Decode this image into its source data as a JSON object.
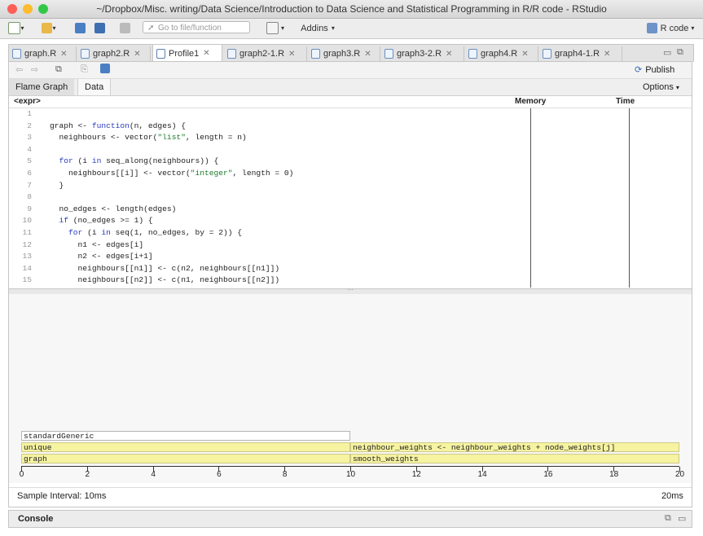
{
  "window": {
    "title": "~/Dropbox/Misc. writing/Data Science/Introduction to Data Science and Statistical Programming in R/R code - RStudio"
  },
  "toolbar": {
    "goto_placeholder": "Go to file/function",
    "addins_label": "Addins",
    "project_label": "R code"
  },
  "tabs": [
    {
      "label": "graph.R"
    },
    {
      "label": "graph2.R"
    },
    {
      "label": "Profile1"
    },
    {
      "label": "graph2-1.R"
    },
    {
      "label": "graph3.R"
    },
    {
      "label": "graph3-2.R"
    },
    {
      "label": "graph4.R"
    },
    {
      "label": "graph4-1.R"
    }
  ],
  "profile": {
    "publish_label": "Publish",
    "view_tabs": {
      "flame": "Flame Graph",
      "data": "Data"
    },
    "options_label": "Options",
    "columns": {
      "expr": "<expr>",
      "memory": "Memory",
      "time": "Time"
    },
    "code_lines": [
      {
        "n": "1",
        "t": ""
      },
      {
        "n": "2",
        "t": "graph <- function(n, edges) {"
      },
      {
        "n": "3",
        "t": "  neighbours <- vector(\"list\", length = n)"
      },
      {
        "n": "4",
        "t": ""
      },
      {
        "n": "5",
        "t": "  for (i in seq_along(neighbours)) {"
      },
      {
        "n": "6",
        "t": "    neighbours[[i]] <- vector(\"integer\", length = 0)"
      },
      {
        "n": "7",
        "t": "  }"
      },
      {
        "n": "8",
        "t": ""
      },
      {
        "n": "9",
        "t": "  no_edges <- length(edges)"
      },
      {
        "n": "10",
        "t": "  if (no_edges >= 1) {"
      },
      {
        "n": "11",
        "t": "    for (i in seq(1, no_edges, by = 2)) {"
      },
      {
        "n": "12",
        "t": "      n1 <- edges[i]"
      },
      {
        "n": "13",
        "t": "      n2 <- edges[i+1]"
      },
      {
        "n": "14",
        "t": "      neighbours[[n1]] <- c(n2, neighbours[[n1]])"
      },
      {
        "n": "15",
        "t": "      neighbours[[n2]] <- c(n1, neighbours[[n2]])"
      }
    ],
    "flame_blocks": [
      {
        "label": "standardGeneric",
        "start": 0,
        "end": 10,
        "level": 2,
        "color": "#ffffff"
      },
      {
        "label": "unique",
        "start": 0,
        "end": 10,
        "level": 1,
        "color": "#f6f3a1"
      },
      {
        "label": "neighbour_weights <- neighbour_weights + node_weights[j]",
        "start": 10,
        "end": 20,
        "level": 1,
        "color": "#f6f3a1"
      },
      {
        "label": "graph",
        "start": 0,
        "end": 10,
        "level": 0,
        "color": "#f6f3a1"
      },
      {
        "label": "smooth_weights",
        "start": 10,
        "end": 20,
        "level": 0,
        "color": "#f6f3a1"
      }
    ],
    "axis_ticks": [
      "0",
      "2",
      "4",
      "6",
      "8",
      "10",
      "12",
      "14",
      "16",
      "18",
      "20"
    ],
    "axis_max": 20,
    "sample_interval": "Sample Interval: 10ms",
    "total_time": "20ms"
  },
  "console": {
    "label": "Console"
  }
}
